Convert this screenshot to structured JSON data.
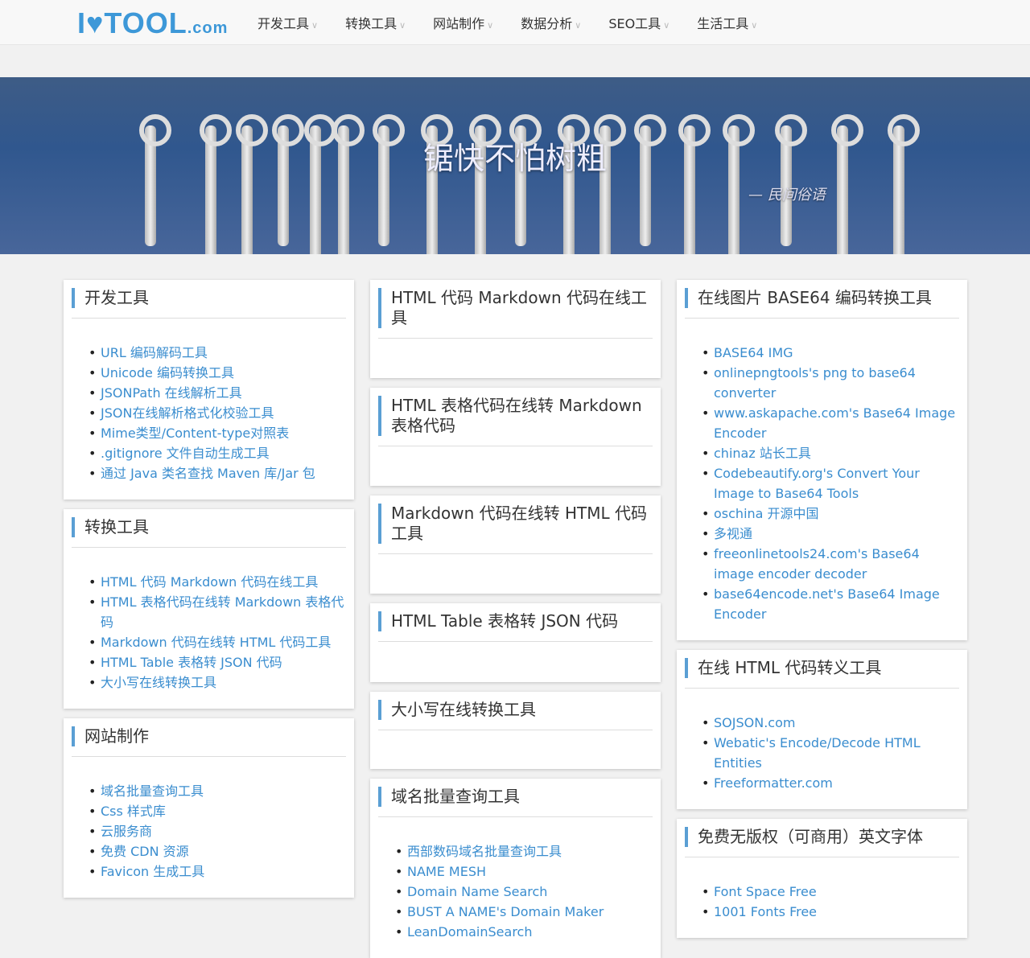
{
  "header": {
    "logo_main": "I♥TOOL",
    "logo_suffix": ".com",
    "nav": [
      "开发工具",
      "转换工具",
      "网站制作",
      "数据分析",
      "SEO工具",
      "生活工具"
    ]
  },
  "banner": {
    "quote": "锯快不怕树粗",
    "source": "— 民间俗语"
  },
  "columns": [
    [
      {
        "title": "开发工具",
        "items": [
          "URL 编码解码工具",
          "Unicode 编码转换工具",
          "JSONPath 在线解析工具",
          "JSON在线解析格式化校验工具",
          "Mime类型/Content-type对照表",
          ".gitignore 文件自动生成工具",
          "通过 Java 类名查找 Maven 库/Jar 包"
        ]
      },
      {
        "title": "转换工具",
        "items": [
          "HTML 代码 Markdown 代码在线工具",
          "HTML 表格代码在线转 Markdown 表格代码",
          "Markdown 代码在线转 HTML 代码工具",
          "HTML Table 表格转 JSON 代码",
          "大小写在线转换工具"
        ]
      },
      {
        "title": "网站制作",
        "items": [
          "域名批量查询工具",
          "Css 样式库",
          "云服务商",
          "免费 CDN 资源",
          "Favicon 生成工具"
        ]
      }
    ],
    [
      {
        "title": "HTML 代码 Markdown 代码在线工具",
        "items": []
      },
      {
        "title": "HTML 表格代码在线转 Markdown 表格代码",
        "items": []
      },
      {
        "title": "Markdown 代码在线转 HTML 代码工具",
        "items": []
      },
      {
        "title": "HTML Table 表格转 JSON 代码",
        "items": []
      },
      {
        "title": "大小写在线转换工具",
        "items": []
      },
      {
        "title": "域名批量查询工具",
        "items": [
          "西部数码域名批量查询工具",
          "NAME MESH",
          "Domain Name Search",
          "BUST A NAME's Domain Maker",
          "LeanDomainSearch"
        ]
      }
    ],
    [
      {
        "title": "在线图片 BASE64 编码转换工具",
        "items": [
          "BASE64 IMG",
          "onlinepngtools's png to base64 converter",
          "www.askapache.com's Base64 Image Encoder",
          "chinaz 站长工具",
          "Codebeautify.org's Convert Your Image to Base64 Tools",
          "oschina 开源中国",
          "多视通",
          "freeonlinetools24.com's Base64 image encoder decoder",
          "base64encode.net's Base64 Image Encoder"
        ]
      },
      {
        "title": "在线 HTML 代码转义工具",
        "items": [
          "SOJSON.com",
          "Webatic's Encode/Decode HTML Entities",
          "Freeformatter.com"
        ]
      },
      {
        "title": "免费无版权（可商用）英文字体",
        "items": [
          "Font Space Free",
          "1001 Fonts Free"
        ]
      }
    ]
  ]
}
